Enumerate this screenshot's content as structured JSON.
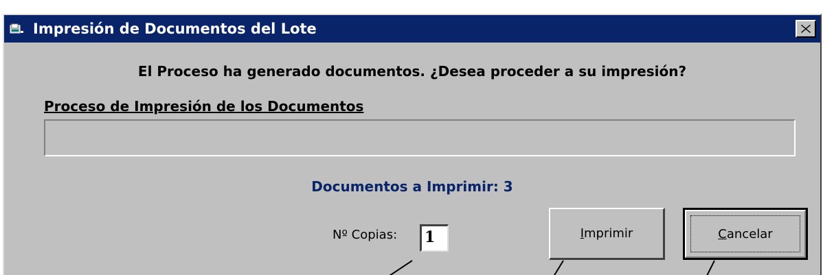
{
  "window": {
    "title": "Impresión de Documentos del Lote",
    "icon": "printer-document-icon",
    "close_icon": "close-x-icon"
  },
  "dialog": {
    "question": "El Proceso ha generado documentos. ¿Desea proceder a su impresión?",
    "progress_label": "Proceso de Impresión de los Documentos",
    "progress_value": 0,
    "documents_count_text": "Documentos a Imprimir: 3",
    "copies_label": "Nº Copias:",
    "copies_value": "1",
    "print_button": {
      "mnemonic": "I",
      "rest": "mprimir"
    },
    "cancel_button": {
      "mnemonic": "C",
      "rest": "ancelar"
    }
  },
  "colors": {
    "title_bar": "#0a246a",
    "dialog_face": "#c0c0c0",
    "count_text": "#0a246a"
  }
}
